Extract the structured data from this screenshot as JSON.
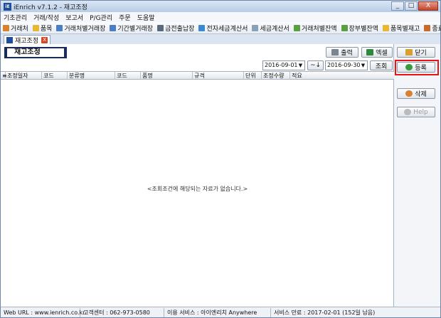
{
  "window": {
    "title": "iEnrich v7.1.2 - 재고조정",
    "app_icon": "iE",
    "minimize": "_",
    "maximize": "□",
    "close": "X"
  },
  "menu": [
    "기초관리",
    "거래/작성",
    "보고서",
    "P/G관리",
    "주문",
    "도움말"
  ],
  "toolbar": [
    {
      "label": "거래처",
      "icon": "truck-icon",
      "color": "#d9822b"
    },
    {
      "label": "품목",
      "icon": "box-icon",
      "color": "#e8b830"
    },
    {
      "label": "거래처별거래장",
      "icon": "ledger-icon",
      "color": "#4a7fc7"
    },
    {
      "label": "기간별거래장",
      "icon": "ledger-icon",
      "color": "#4a7fc7"
    },
    {
      "label": "금전출납장",
      "icon": "grid-icon",
      "color": "#5a6a7a"
    },
    {
      "label": "전자세금계산서",
      "icon": "doc-icon",
      "color": "#3a8ad0"
    },
    {
      "label": "세금계산서",
      "icon": "doc-icon",
      "color": "#8aa0b8"
    },
    {
      "label": "거래처별잔액",
      "icon": "tag-icon",
      "color": "#5aa040"
    },
    {
      "label": "장부별잔액",
      "icon": "tag-icon",
      "color": "#5aa040"
    },
    {
      "label": "품목별재고",
      "icon": "box-icon",
      "color": "#e8b830"
    },
    {
      "label": "종료",
      "icon": "exit-icon",
      "color": "#c86a2a"
    }
  ],
  "tab": {
    "label": "재고조정",
    "close": "X"
  },
  "page": {
    "title": "재고조정"
  },
  "actions": {
    "print": "출력",
    "excel": "엑셀",
    "close": "닫기"
  },
  "filter": {
    "date_from": "2016-09-01",
    "range_sep": "~↓",
    "date_to": "2016-09-30",
    "search": "조회"
  },
  "side": {
    "register": "등록",
    "delete": "삭제",
    "help": "Help"
  },
  "table": {
    "columns": [
      "조정일자",
      "코드",
      "분류명",
      "코드",
      "품명",
      "규격",
      "단위",
      "조정수량",
      "적요"
    ]
  },
  "empty_message": "<조회조건에 해당되는 자료가 없습니다.>",
  "status": {
    "web": "Web URL : www.ienrich.co.kr",
    "support": "고객센터 : 062-973-0580",
    "service": "이용 서비스 : 아이엔리치 Anywhere",
    "expiry": "서비스 만료 : 2017-02-01 (152일 남음)"
  },
  "colors": {
    "highlight": "#ee1111",
    "title_border": "#1a2d5a"
  }
}
